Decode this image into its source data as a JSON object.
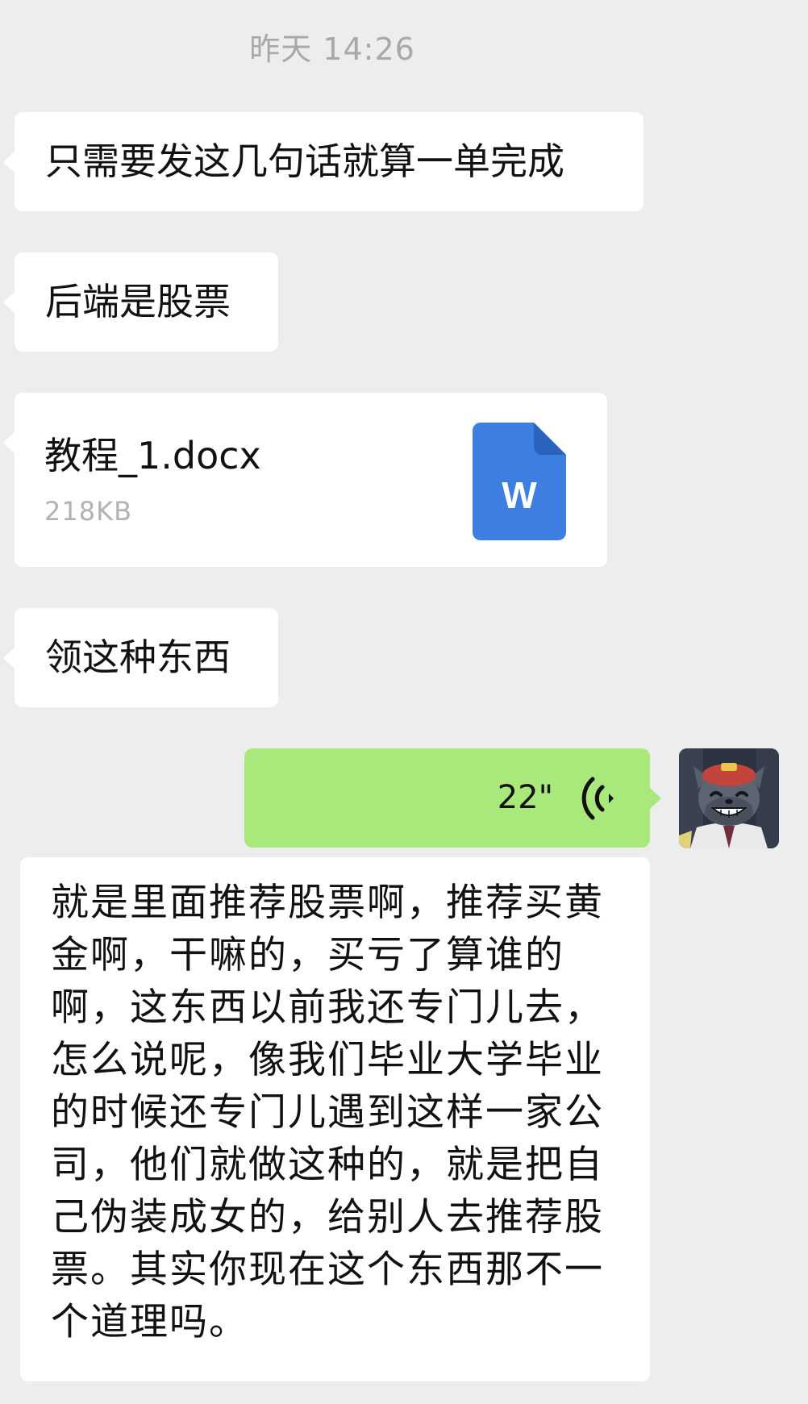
{
  "header": {
    "timestamp": "昨天 14:26"
  },
  "messages": [
    {
      "sender": "other",
      "type": "text",
      "text": "只需要发这几句话就算一单完成"
    },
    {
      "sender": "other",
      "type": "text",
      "text": "后端是股票"
    },
    {
      "sender": "other",
      "type": "file",
      "file_name": "教程_1.docx",
      "file_size": "218KB",
      "icon": "word-document-icon",
      "icon_letter": "W"
    },
    {
      "sender": "other",
      "type": "text",
      "text": "领这种东西"
    },
    {
      "sender": "self",
      "type": "voice",
      "duration": "22\"",
      "icon": "voice-wave-icon"
    }
  ],
  "voice_transcript": {
    "text": "就是里面推荐股票啊，推荐买黄金啊，干嘛的，买亏了算谁的啊，这东西以前我还专门儿去，怎么说呢，像我们毕业大学毕业的时候还专门儿遇到这样一家公司，他们就做这种的，就是把自己伪装成女的，给别人去推荐股票。其实你现在这个东西那不一个道理吗。"
  },
  "colors": {
    "background": "#ededed",
    "incoming_bubble": "#ffffff",
    "outgoing_bubble": "#a9e97c",
    "timestamp_text": "#a8a8a8",
    "file_size_text": "#b2b2b2",
    "word_blue": "#3c7fe0"
  }
}
